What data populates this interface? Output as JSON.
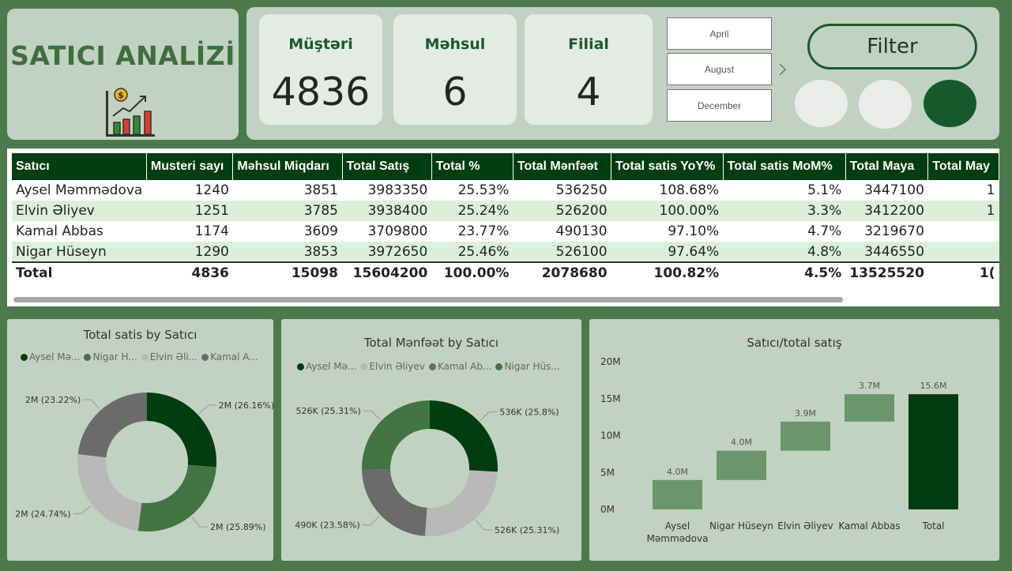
{
  "title": "SATICI ANALİZİ",
  "kpis": [
    {
      "label": "Müştəri",
      "value": "4836"
    },
    {
      "label": "Məhsul",
      "value": "6"
    },
    {
      "label": "Filial",
      "value": "4"
    }
  ],
  "months": [
    "April",
    "August",
    "December"
  ],
  "filter_label": "Filter",
  "colors": {
    "dark_green": "#003d10",
    "mid_green": "#437443",
    "light_gray": "#b9b9b9",
    "dark_gray": "#6b6b6b",
    "waterfall_green": "#6b956b",
    "total_green": "#003d10"
  },
  "table": {
    "headers": [
      "Satıcı",
      "Musteri sayı",
      "Məhsul Miqdarı",
      "Total Satış",
      "Total %",
      "Total Mənfəət",
      "Total satis YoY%",
      "Total satis MoM%",
      "Total Maya",
      "Total May"
    ],
    "rows": [
      [
        "Aysel Məmmədova",
        "1240",
        "3851",
        "3983350",
        "25.53%",
        "536250",
        "108.68%",
        "5.1%",
        "3447100",
        "1"
      ],
      [
        "Elvin Əliyev",
        "1251",
        "3785",
        "3938400",
        "25.24%",
        "526200",
        "100.00%",
        "3.3%",
        "3412200",
        "1"
      ],
      [
        "Kamal Abbas",
        "1174",
        "3609",
        "3709800",
        "23.77%",
        "490130",
        "97.10%",
        "4.7%",
        "3219670",
        ""
      ],
      [
        "Nigar Hüseyn",
        "1290",
        "3853",
        "3972650",
        "25.46%",
        "526100",
        "97.64%",
        "4.8%",
        "3446550",
        ""
      ]
    ],
    "total": [
      "Total",
      "4836",
      "15098",
      "15604200",
      "100.00%",
      "2078680",
      "100.82%",
      "4.5%",
      "13525520",
      "1("
    ]
  },
  "chart_data": [
    {
      "type": "pie",
      "title": "Total satis by Satıcı",
      "legend": [
        "Aysel Mə...",
        "Nigar H...",
        "Elvin Əli...",
        "Kamal A..."
      ],
      "legend_placement": "top",
      "slices": [
        {
          "name": "Aysel Məmmədova",
          "value": 26.16,
          "label": "2M (26.16%)",
          "color": "#003d10"
        },
        {
          "name": "Nigar Hüseyn",
          "value": 25.89,
          "label": "2M (25.89%)",
          "color": "#437443"
        },
        {
          "name": "Elvin Əliyev",
          "value": 24.74,
          "label": "2M (24.74%)",
          "color": "#b9b9b9"
        },
        {
          "name": "Kamal Abbas",
          "value": 23.22,
          "label": "2M (23.22%)",
          "color": "#6b6b6b"
        }
      ]
    },
    {
      "type": "pie",
      "title": "Total Mənfəət by Satıcı",
      "legend": [
        "Aysel Mə...",
        "Elvin Əliyev",
        "Kamal Ab...",
        "Nigar Hüs..."
      ],
      "legend_placement": "top",
      "slices": [
        {
          "name": "Aysel Məmmədova",
          "value": 25.8,
          "label": "536K (25.8%)",
          "color": "#003d10"
        },
        {
          "name": "Elvin Əliyev",
          "value": 25.31,
          "label": "526K (25.31%)",
          "color": "#b9b9b9"
        },
        {
          "name": "Kamal Abbas",
          "value": 23.58,
          "label": "490K (23.58%)",
          "color": "#6b6b6b"
        },
        {
          "name": "Nigar Hüseyn",
          "value": 25.31,
          "label": "526K (25.31%)",
          "color": "#437443"
        }
      ]
    },
    {
      "type": "bar",
      "subtype": "waterfall",
      "title": "Satıcı/total satış",
      "categories": [
        "Aysel Məmmədova",
        "Nigar Hüseyn",
        "Elvin Əliyev",
        "Kamal Abbas",
        "Total"
      ],
      "values": [
        3.98,
        3.97,
        3.94,
        3.71,
        15.6
      ],
      "labels": [
        "4.0M",
        "4.0M",
        "3.9M",
        "3.7M",
        "15.6M"
      ],
      "yticks": [
        "0M",
        "5M",
        "10M",
        "15M",
        "20M"
      ],
      "ylim": [
        0,
        20
      ]
    }
  ]
}
